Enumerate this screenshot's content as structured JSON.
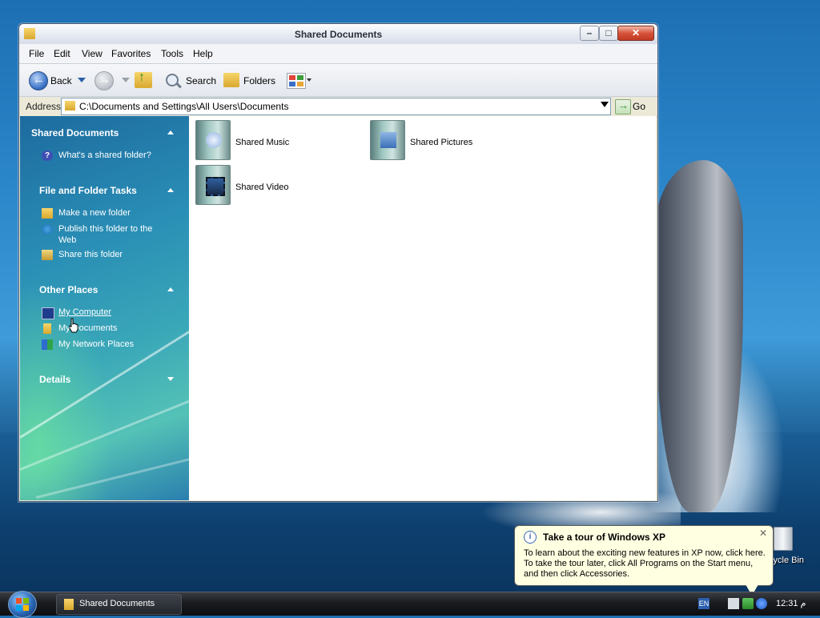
{
  "window": {
    "title": "Shared Documents",
    "min_glyph": "–",
    "max_glyph": "□",
    "close_glyph": "✕"
  },
  "menu": [
    "File",
    "Edit",
    "View",
    "Favorites",
    "Tools",
    "Help"
  ],
  "toolbar": {
    "back_label": "Back",
    "search_label": "Search",
    "folders_label": "Folders"
  },
  "address": {
    "label": "Address",
    "value": "C:\\Documents and Settings\\All Users\\Documents",
    "go_label": "Go"
  },
  "taskpane": {
    "sections": [
      {
        "title": "Shared Documents",
        "links": [
          "What's a shared folder?"
        ]
      },
      {
        "title": "File and Folder Tasks",
        "links": [
          "Make a new folder",
          "Publish this folder to the",
          "Web",
          "Share this folder"
        ]
      },
      {
        "title": "Other Places",
        "links": [
          "My Computer",
          "My Documents",
          "My Network Places"
        ]
      },
      {
        "title": "Details",
        "links": []
      }
    ]
  },
  "items": [
    {
      "label": "Shared Music",
      "icon": "music-folder-icon"
    },
    {
      "label": "Shared Pictures",
      "icon": "pictures-folder-icon"
    },
    {
      "label": "Shared Video",
      "icon": "video-folder-icon"
    }
  ],
  "desktop": {
    "recycle_label": "cycle Bin"
  },
  "balloon": {
    "title": "Take a tour of Windows XP",
    "lines": [
      "To learn about the exciting new features in XP now, click here.",
      "To take the tour later, click All Programs on the Start menu,",
      "and then click Accessories."
    ],
    "close_glyph": "✕"
  },
  "taskbar": {
    "task_label": "Shared Documents",
    "lang": "EN",
    "clock": "12:31 م"
  },
  "colors": {
    "taskpane_top": "#1d6b9f",
    "taskbar": "#191b1f",
    "balloon_bg": "#ffffe1"
  }
}
